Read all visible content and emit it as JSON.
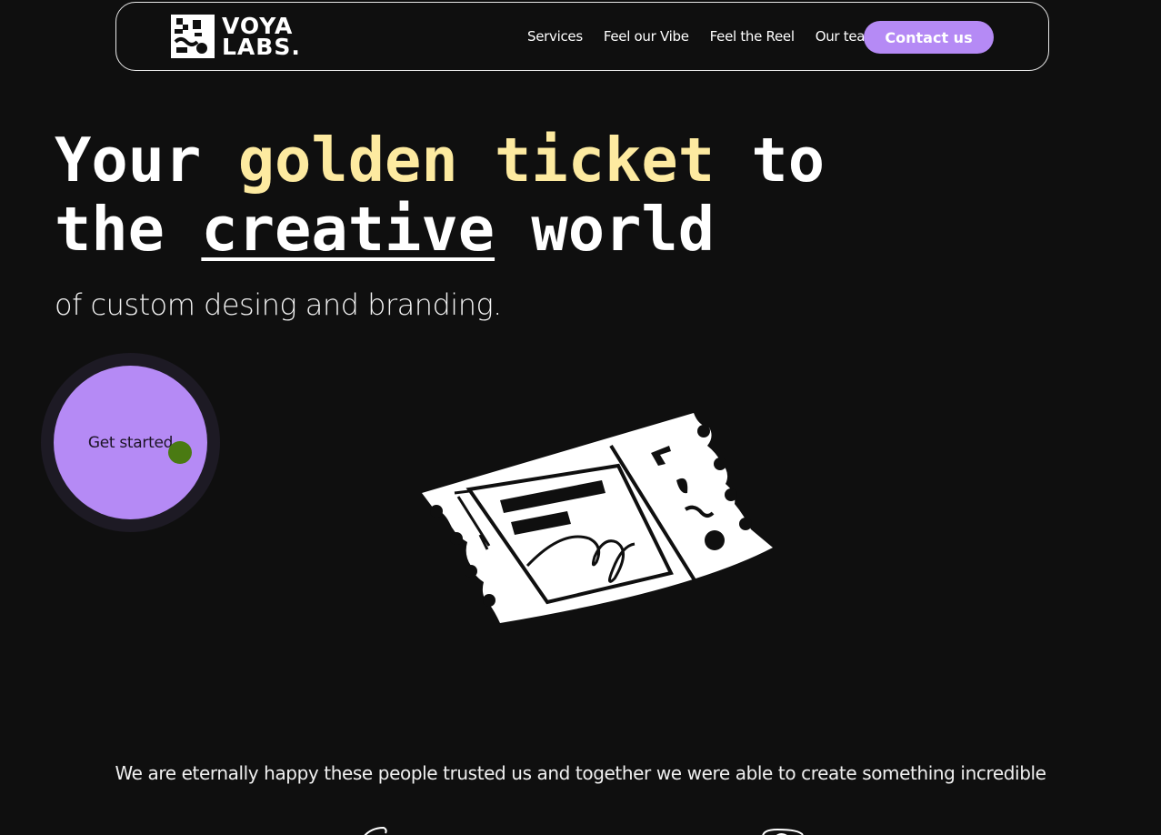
{
  "header": {
    "logo": {
      "line1": "VOYA",
      "line2": "LABS.",
      "icon": "voya-labs-logo-icon"
    },
    "nav": [
      {
        "label": "Services"
      },
      {
        "label": "Feel our Vibe"
      },
      {
        "label": "Feel the Reel"
      },
      {
        "label": "Our team"
      }
    ],
    "contact_label": "Contact us"
  },
  "hero": {
    "line1_a": "Your ",
    "line1_gold": "golden ticket",
    "line1_b": " to",
    "line2_a": "the ",
    "line2_under": "creative",
    "line2_b": " world",
    "subline": "of custom desing and branding.",
    "cta_label": "Get started",
    "illustration_icon": "ticket-illustration"
  },
  "trust": {
    "text": "We are eternally happy these people trusted us and together we were able to create something incredible",
    "logo_icons": [
      "partner-logo-icon",
      "partner-logo-icon"
    ]
  },
  "colors": {
    "background": "#0f0f0f",
    "accent": "#b58af5",
    "gold": "#fdeaa0",
    "cursor_dot": "#4a7a12"
  }
}
